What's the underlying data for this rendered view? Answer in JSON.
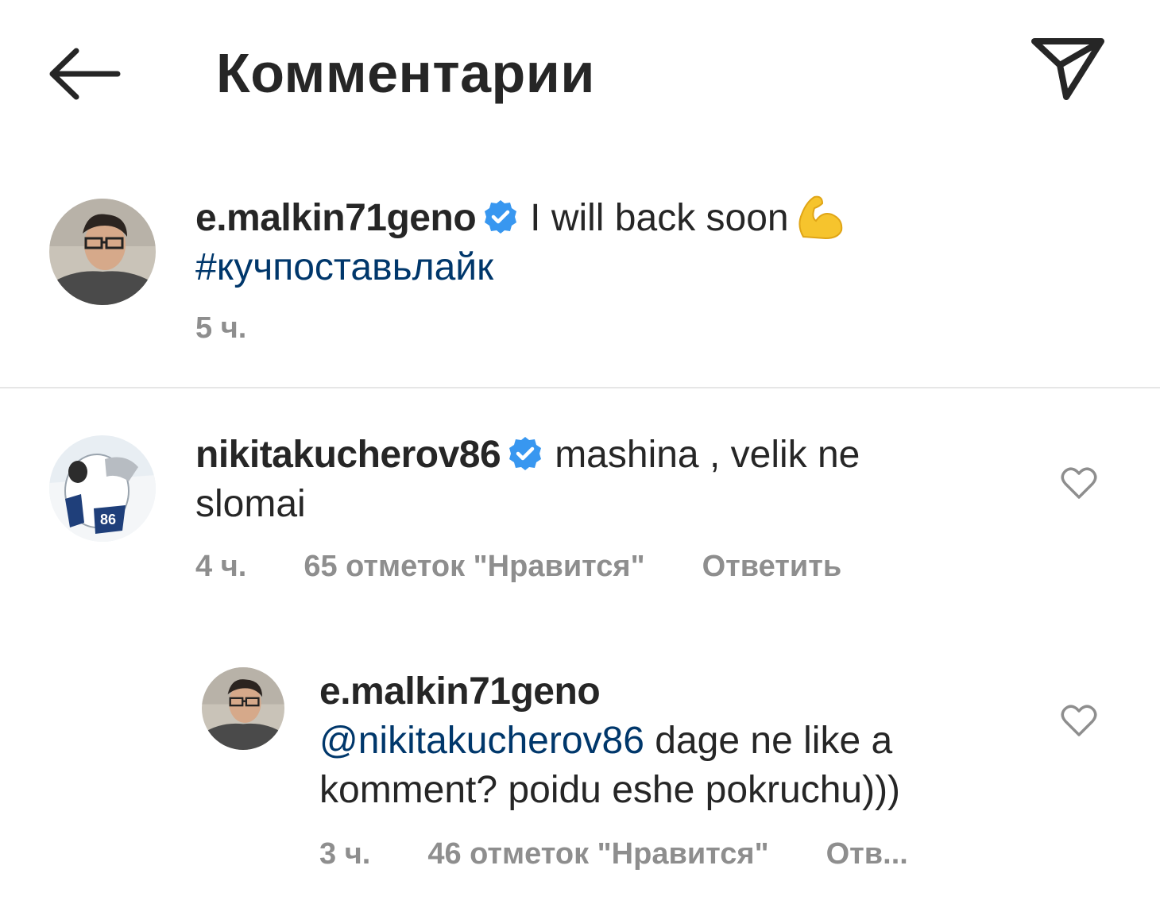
{
  "header": {
    "title": "Комментарии",
    "back_icon": "arrow-left-icon",
    "send_icon": "paper-plane-icon"
  },
  "caption": {
    "username": "e.malkin71geno",
    "text": "I will back soon",
    "emoji": "flexed-biceps",
    "hashtag": "#кучпоставьлайк",
    "time": "5 ч."
  },
  "comments": [
    {
      "username": "nikitakucherov86",
      "verified": true,
      "text_line1": "mashina , velik ne",
      "text_line2": "slomai",
      "time": "4 ч.",
      "likes": "65 отметок \"Нравится\"",
      "reply": "Ответить"
    },
    {
      "username": "e.malkin71geno",
      "verified": false,
      "mention": "@nikitakucherov86",
      "text_line1": "dage ne like a",
      "text_line2": "komment? poidu eshe pokruchu)))",
      "time": "3 ч.",
      "likes": "46 отметок \"Нравится\"",
      "reply": "Отв..."
    }
  ],
  "colors": {
    "text": "#262626",
    "secondary": "#8e8e8e",
    "link": "#00376b",
    "verified": "#3897f0",
    "divider": "#e6e6e6"
  }
}
